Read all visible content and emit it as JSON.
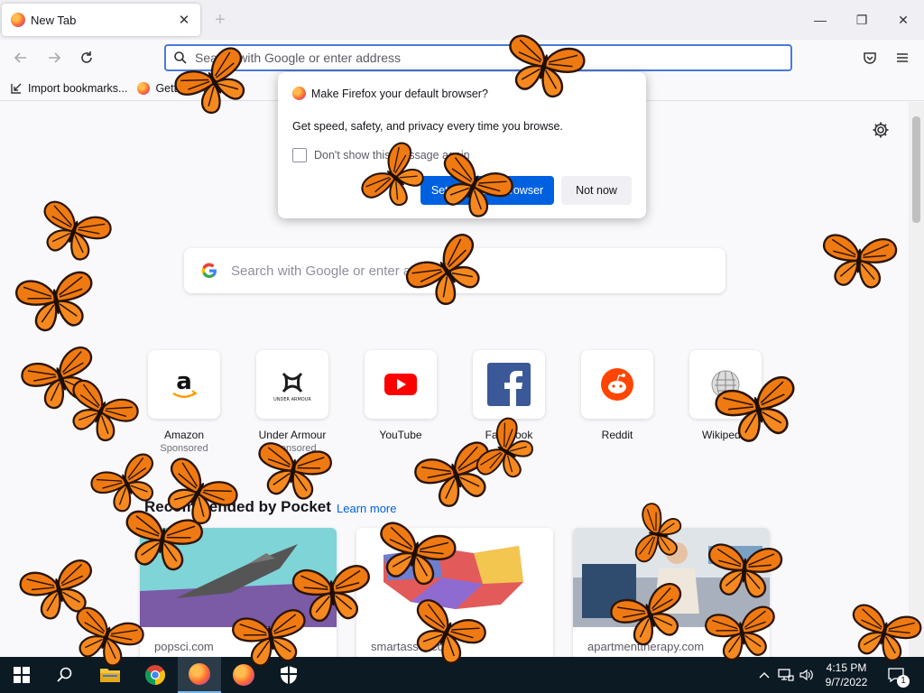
{
  "tab": {
    "title": "New Tab",
    "close": "✕",
    "new": "+"
  },
  "window": {
    "minimize": "—",
    "maximize": "❐",
    "close": "✕"
  },
  "urlbar": {
    "placeholder": "Search with Google or enter address"
  },
  "bookmarks": [
    {
      "label": "Import bookmarks..."
    },
    {
      "label": "Getting Started"
    }
  ],
  "dialog": {
    "title": "Make Firefox your default browser?",
    "text": "Get speed, safety, and privacy every time you browse.",
    "checkbox_label": "Don't show this message again",
    "primary": "Set as default browser",
    "secondary": "Not now"
  },
  "search": {
    "placeholder": "Search with Google or enter address"
  },
  "tiles": [
    {
      "label": "Amazon",
      "sub": "Sponsored",
      "icon": "amazon-logo"
    },
    {
      "label": "Under Armour",
      "sub": "Sponsored",
      "icon": "under-armour-logo"
    },
    {
      "label": "YouTube",
      "sub": "",
      "icon": "youtube-logo"
    },
    {
      "label": "Facebook",
      "sub": "",
      "icon": "facebook-logo"
    },
    {
      "label": "Reddit",
      "sub": "",
      "icon": "reddit-logo"
    },
    {
      "label": "Wikipedia",
      "sub": "",
      "icon": "wikipedia-logo"
    }
  ],
  "tile_text": {
    "under_armour": "UNDER ARMOUR"
  },
  "pocket": {
    "heading": "Recommended by Pocket",
    "link": "Learn more"
  },
  "stories": [
    {
      "source": "popsci.com"
    },
    {
      "source": "smartasset.com"
    },
    {
      "source": "apartmenttherapy.com"
    }
  ],
  "taskbar": {
    "time": "4:15 PM",
    "date": "9/7/2022",
    "notifications": "1",
    "apps": [
      "start",
      "search",
      "file-explorer",
      "chrome",
      "firefox",
      "firefox",
      "security"
    ]
  },
  "colors": {
    "accent": "#0061e0",
    "taskbar": "#0c1a24",
    "butterfly": "#f07a12"
  }
}
